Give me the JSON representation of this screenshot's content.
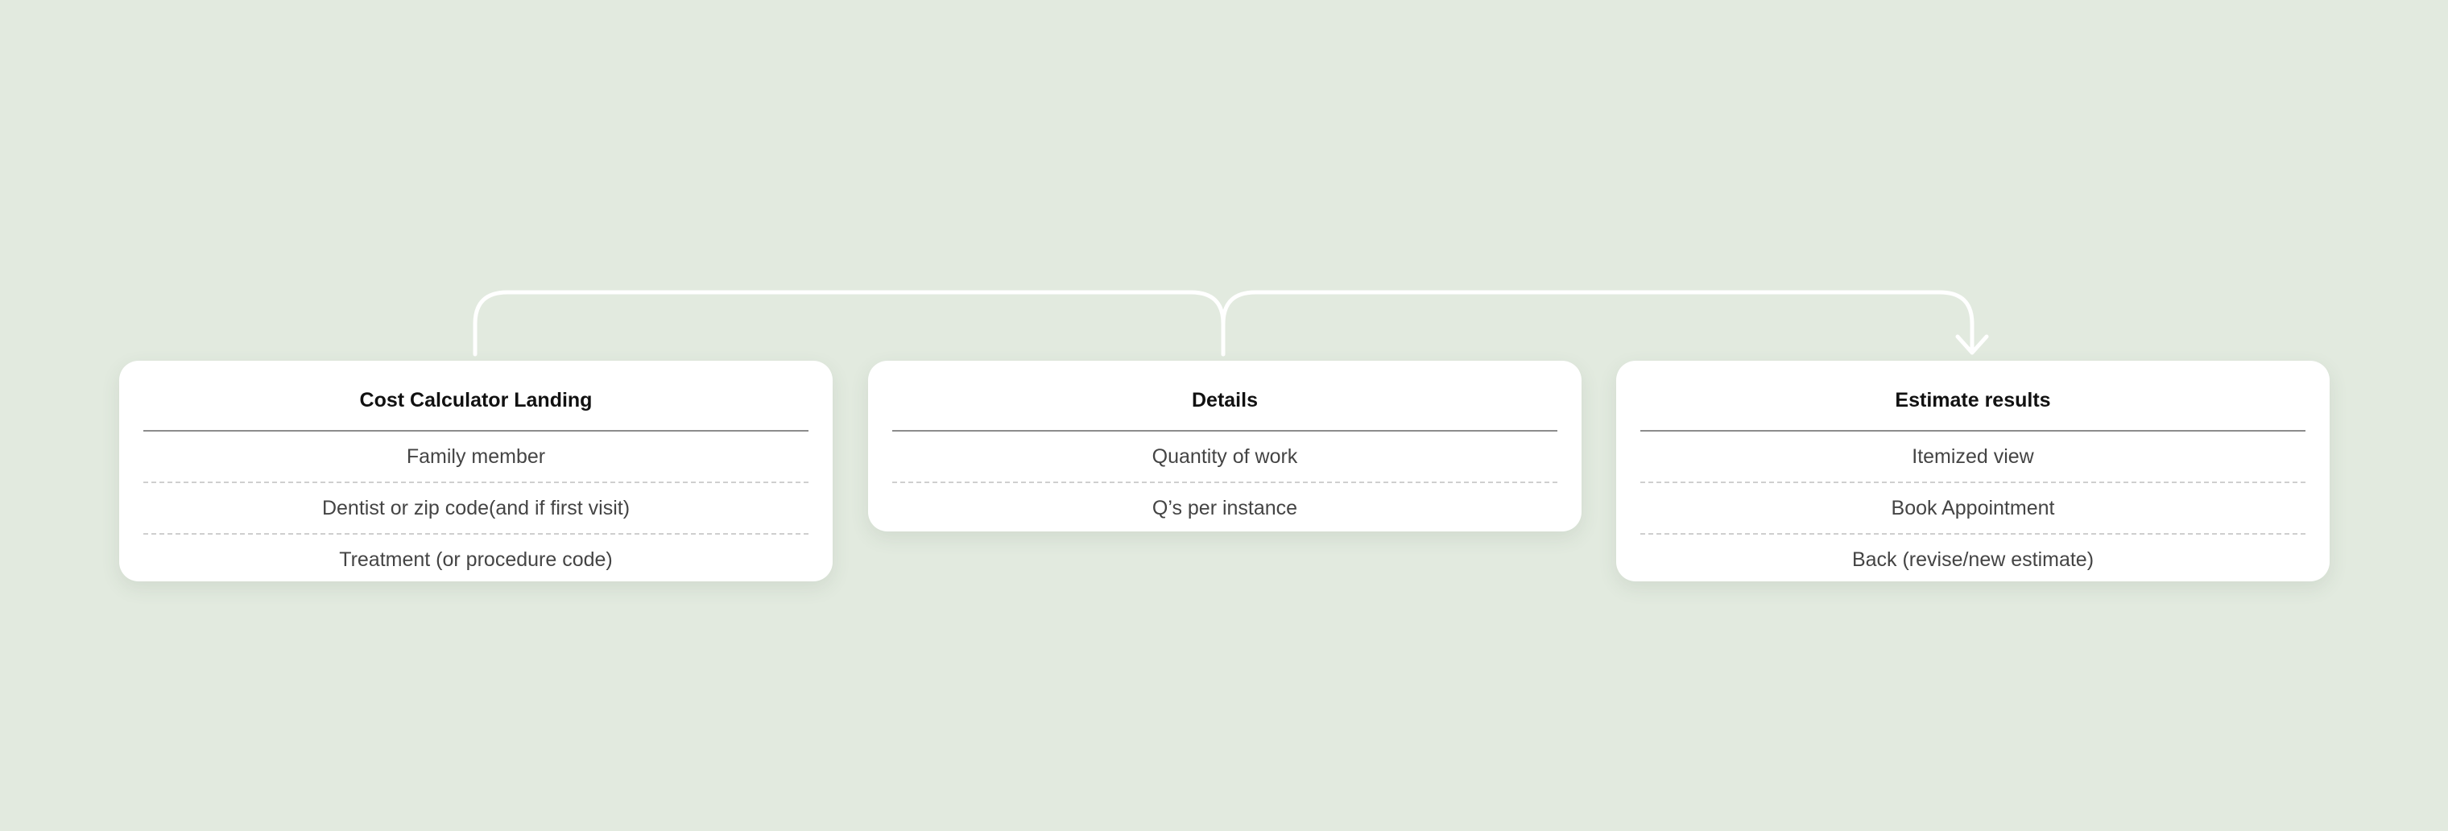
{
  "diagram": {
    "nodes": [
      {
        "id": "landing",
        "title": "Cost Calculator Landing",
        "items": [
          "Family member",
          "Dentist or zip code(and if first visit)",
          "Treatment (or procedure code)"
        ]
      },
      {
        "id": "details",
        "title": "Details",
        "items": [
          "Quantity of work",
          "Q’s per instance"
        ]
      },
      {
        "id": "estimate",
        "title": "Estimate results",
        "items": [
          "Itemized view",
          "Book Appointment",
          "Back (revise/new estimate)"
        ]
      }
    ],
    "edges": [
      {
        "from": "landing",
        "to": "details"
      },
      {
        "from": "details",
        "to": "estimate"
      }
    ],
    "colors": {
      "background": "#e2eadf",
      "card": "#ffffff",
      "connector": "#ffffff",
      "title_text": "#111111",
      "item_text": "#444444"
    }
  }
}
